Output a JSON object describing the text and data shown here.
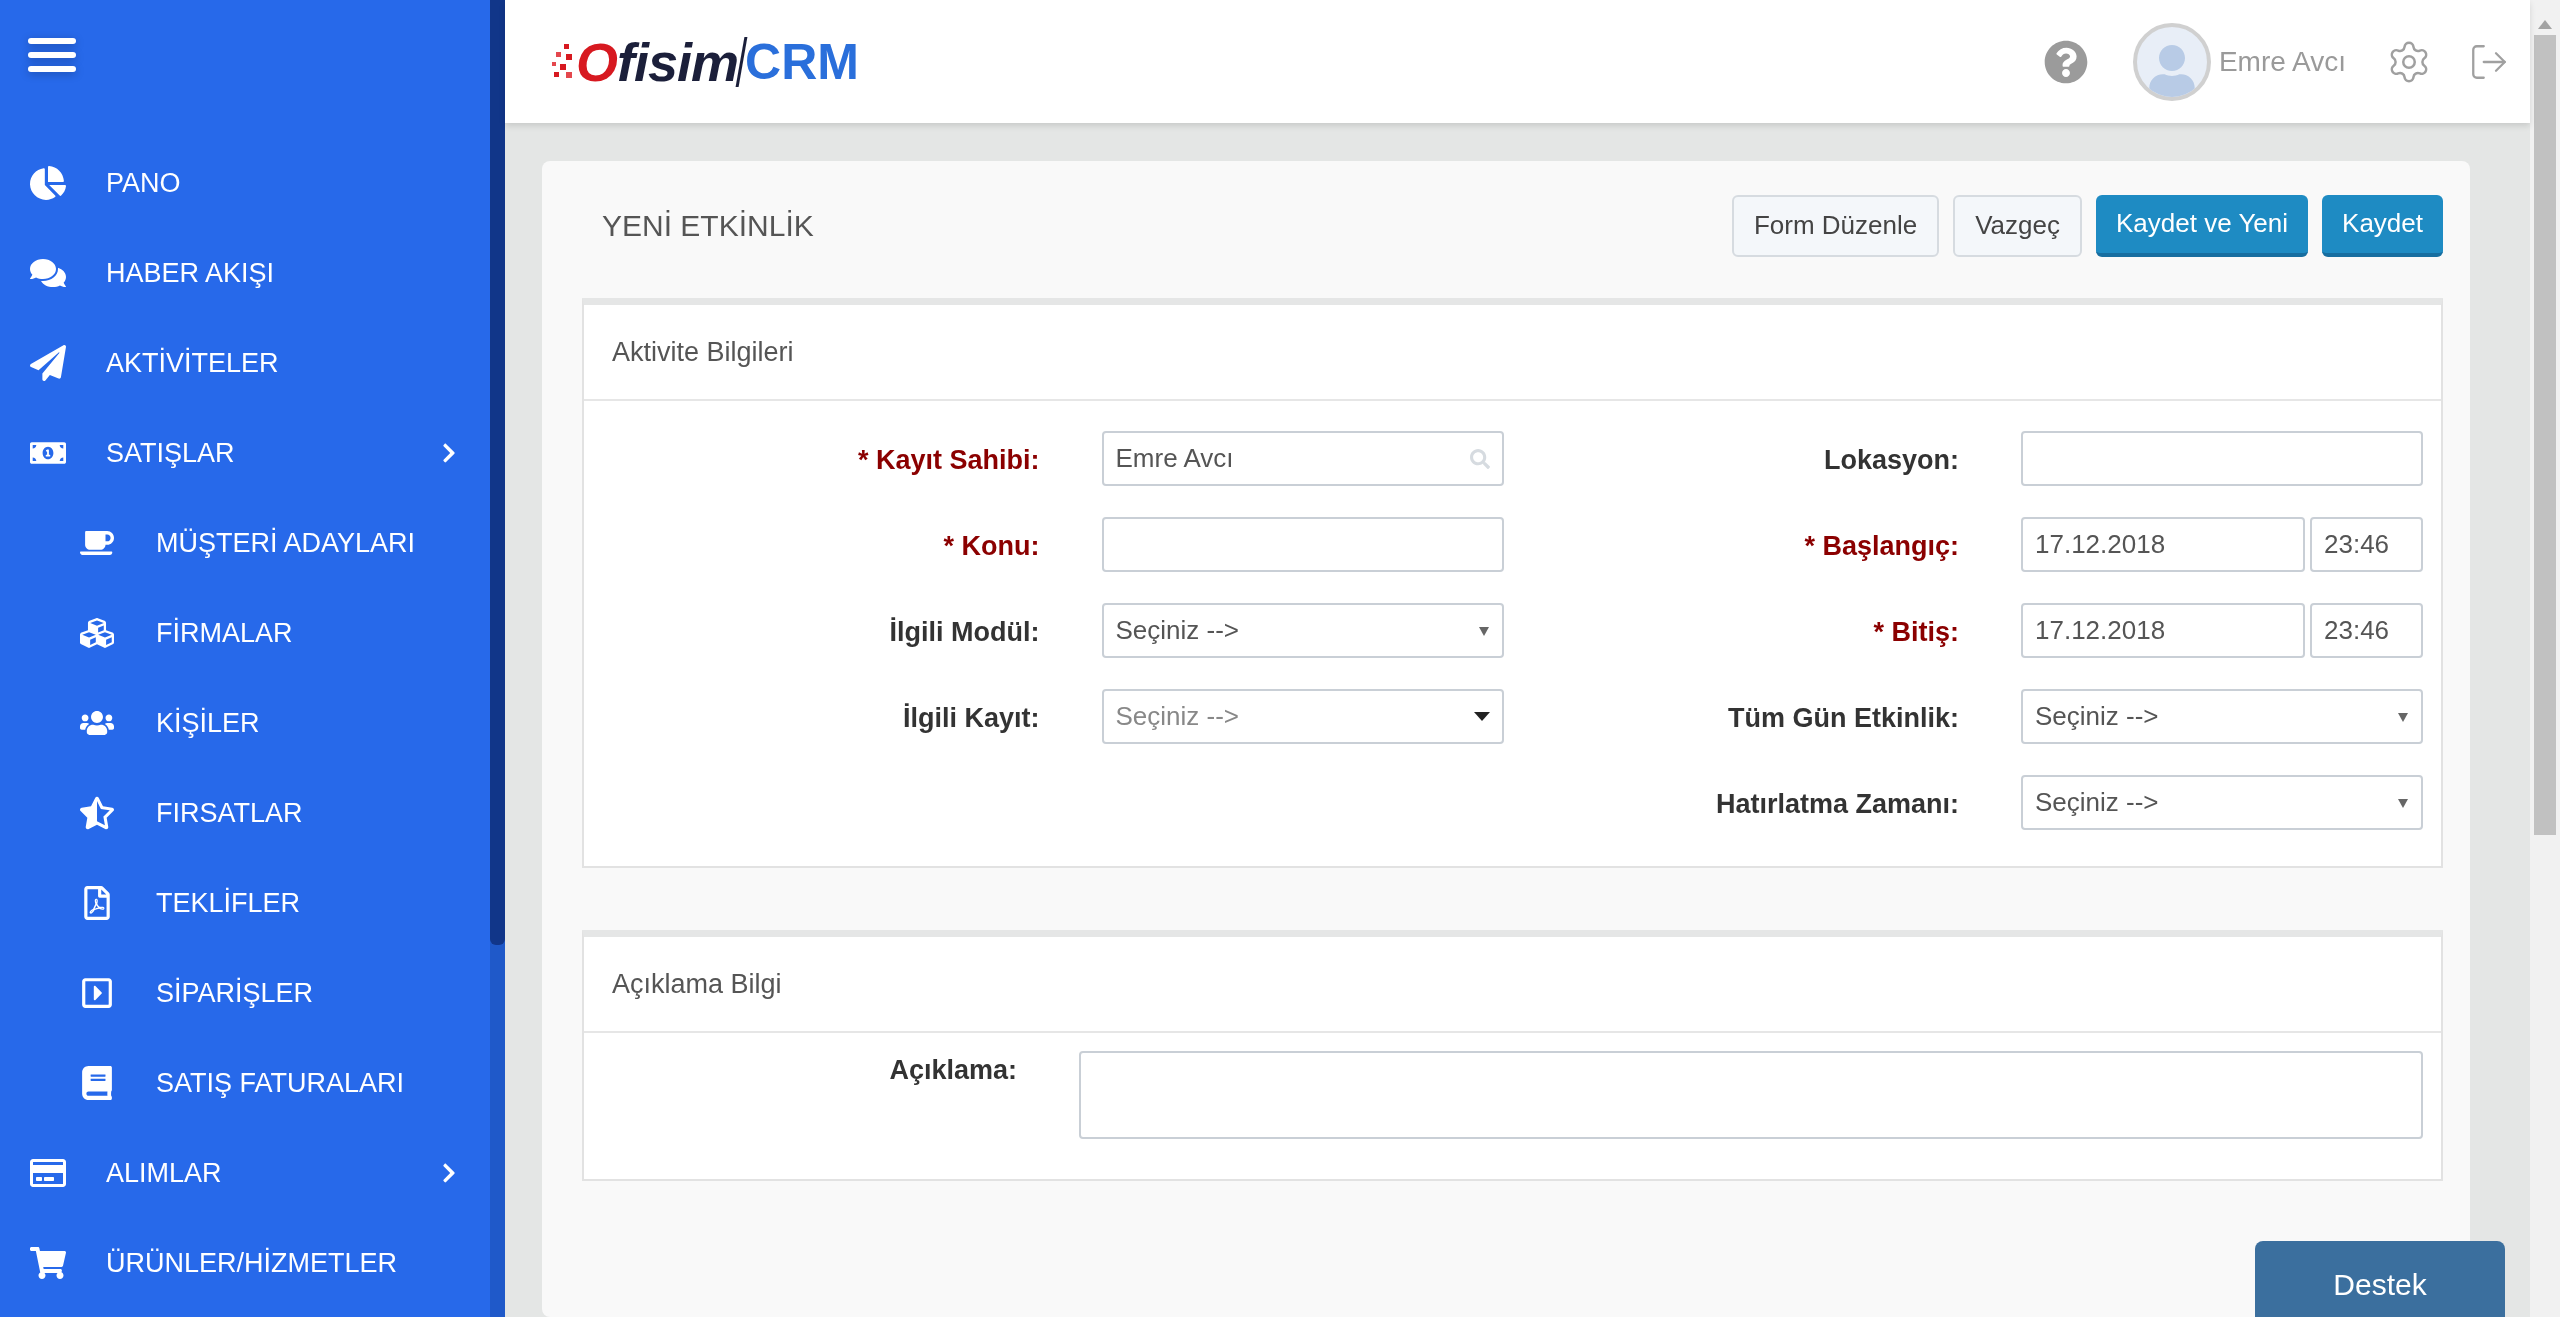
{
  "sidebar": {
    "items": [
      {
        "label": "PANO",
        "expandable": false
      },
      {
        "label": "HABER AKIŞI",
        "expandable": false
      },
      {
        "label": "AKTİVİTELER",
        "expandable": false
      },
      {
        "label": "SATIŞLAR",
        "expandable": true,
        "children": [
          {
            "label": "MÜŞTERİ ADAYLARI"
          },
          {
            "label": "FİRMALAR"
          },
          {
            "label": "KİŞİLER"
          },
          {
            "label": "FIRSATLAR"
          },
          {
            "label": "TEKLİFLER"
          },
          {
            "label": "SİPARİŞLER"
          },
          {
            "label": "SATIŞ FATURALARI"
          }
        ]
      },
      {
        "label": "ALIMLAR",
        "expandable": true
      },
      {
        "label": "ÜRÜNLER/HİZMETLER",
        "expandable": false
      }
    ]
  },
  "header": {
    "logo": {
      "brand": "Ofisim",
      "product": "CRM"
    },
    "user_name": "Emre Avcı"
  },
  "page": {
    "title": "YENİ ETKİNLİK",
    "buttons": [
      {
        "label": "Form Düzenle",
        "kind": "default"
      },
      {
        "label": "Vazgeç",
        "kind": "default"
      },
      {
        "label": "Kaydet ve Yeni",
        "kind": "primary"
      },
      {
        "label": "Kaydet",
        "kind": "primary"
      }
    ]
  },
  "sections": [
    {
      "title": "Aktivite Bilgileri",
      "columns": [
        [
          {
            "label": "* Kayıt Sahibi:",
            "required": true,
            "kind": "lookup",
            "value": "Emre Avcı"
          },
          {
            "label": "* Konu:",
            "required": true,
            "kind": "text"
          },
          {
            "label": "İlgili Modül:",
            "required": false,
            "kind": "select",
            "value": "Seçiniz -->"
          },
          {
            "label": "İlgili Kayıt:",
            "required": false,
            "kind": "dropdown",
            "placeholder": "Seçiniz -->"
          }
        ],
        [
          {
            "label": "Lokasyon:",
            "required": false,
            "kind": "text"
          },
          {
            "label": "* Başlangıç:",
            "required": true,
            "kind": "datetime",
            "date": "17.12.2018",
            "time": "23:46"
          },
          {
            "label": "* Bitiş:",
            "required": true,
            "kind": "datetime",
            "date": "17.12.2018",
            "time": "23:46"
          },
          {
            "label": "Tüm Gün Etkinlik:",
            "required": false,
            "kind": "select",
            "value": "Seçiniz -->"
          },
          {
            "label": "Hatırlatma Zamanı:",
            "required": false,
            "kind": "select",
            "value": "Seçiniz -->"
          }
        ]
      ]
    },
    {
      "title": "Açıklama Bilgi",
      "fields": [
        {
          "label": "Açıklama:",
          "required": false,
          "kind": "textarea"
        }
      ]
    }
  ],
  "support_button": {
    "label": "Destek"
  }
}
